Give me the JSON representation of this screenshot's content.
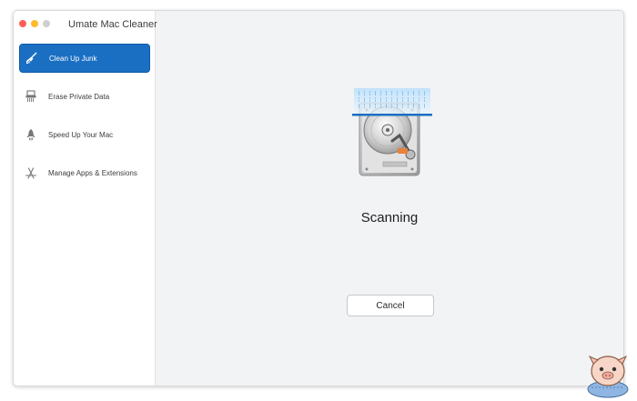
{
  "app": {
    "title": "Umate Mac Cleaner"
  },
  "sidebar": {
    "items": [
      {
        "label": "Clean Up Junk",
        "icon": "broom-icon",
        "active": true
      },
      {
        "label": "Erase Private Data",
        "icon": "shredder-icon",
        "active": false
      },
      {
        "label": "Speed Up Your Mac",
        "icon": "rocket-icon",
        "active": false
      },
      {
        "label": "Manage Apps & Extensions",
        "icon": "app-store-icon",
        "active": false
      }
    ]
  },
  "main": {
    "status": "Scanning",
    "cancel_label": "Cancel",
    "illustration": "hard-drive-scan-icon"
  },
  "colors": {
    "accent": "#1b6fc3",
    "scan_line": "#1a6fc4",
    "background": "#f1f3f5"
  }
}
